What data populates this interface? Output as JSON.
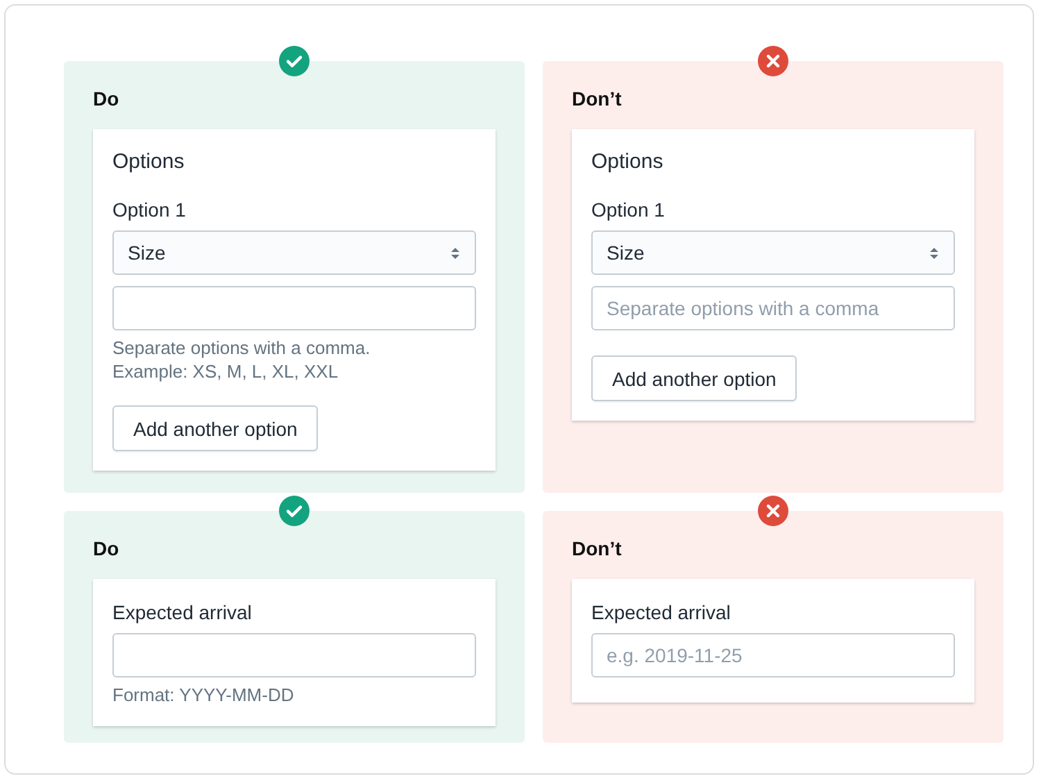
{
  "panels": [
    {
      "kind": "do",
      "title": "Do",
      "card": [
        {
          "kind": "heading",
          "text": "Options"
        },
        {
          "kind": "label",
          "text": "Option 1"
        },
        {
          "kind": "select",
          "value": "Size"
        },
        {
          "kind": "input"
        },
        {
          "kind": "help",
          "text": "Separate options with a comma."
        },
        {
          "kind": "help",
          "text": "Example: XS, M, L, XL, XXL"
        },
        {
          "kind": "button",
          "text": "Add another option"
        }
      ]
    },
    {
      "kind": "dont",
      "title": "Don’t",
      "card": [
        {
          "kind": "heading",
          "text": "Options"
        },
        {
          "kind": "label",
          "text": "Option 1"
        },
        {
          "kind": "select",
          "value": "Size"
        },
        {
          "kind": "input",
          "placeholder": "Separate options with a comma"
        },
        {
          "kind": "button",
          "text": "Add another option"
        }
      ]
    },
    {
      "kind": "do",
      "title": "Do",
      "card": [
        {
          "kind": "label",
          "text": "Expected arrival"
        },
        {
          "kind": "input"
        },
        {
          "kind": "help",
          "text": "Format: YYYY-MM-DD"
        }
      ]
    },
    {
      "kind": "dont",
      "title": "Don’t",
      "card": [
        {
          "kind": "label",
          "text": "Expected arrival"
        },
        {
          "kind": "input",
          "placeholder": "e.g. 2019-11-25"
        }
      ]
    }
  ]
}
